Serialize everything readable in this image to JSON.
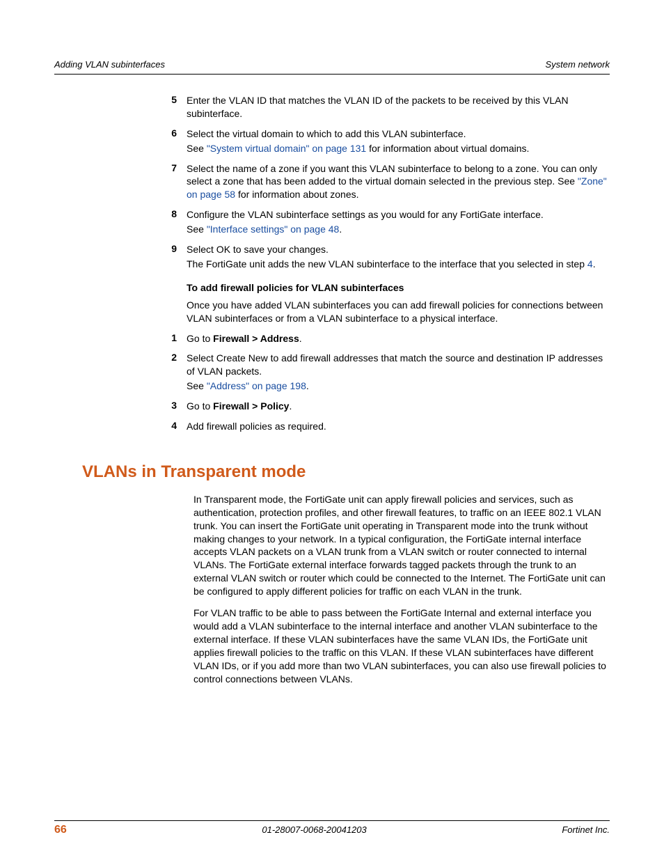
{
  "header": {
    "left": "Adding VLAN subinterfaces",
    "right": "System network"
  },
  "steps1": [
    {
      "n": "5",
      "lines": [
        {
          "segs": [
            {
              "t": "Enter the VLAN ID that matches the VLAN ID of the packets to be received by this VLAN subinterface."
            }
          ]
        }
      ]
    },
    {
      "n": "6",
      "lines": [
        {
          "segs": [
            {
              "t": "Select the virtual domain to which to add this VLAN subinterface."
            }
          ]
        },
        {
          "segs": [
            {
              "t": "See "
            },
            {
              "t": "\"System virtual domain\" on page 131",
              "link": true
            },
            {
              "t": " for information about virtual domains."
            }
          ]
        }
      ]
    },
    {
      "n": "7",
      "lines": [
        {
          "segs": [
            {
              "t": "Select the name of a zone if you want this VLAN subinterface to belong to a zone. You can only select a zone that has been added to the virtual domain selected in the previous step. See "
            },
            {
              "t": "\"Zone\" on page 58",
              "link": true
            },
            {
              "t": " for information about zones."
            }
          ]
        }
      ]
    },
    {
      "n": "8",
      "lines": [
        {
          "segs": [
            {
              "t": "Configure the VLAN subinterface settings as you would for any FortiGate interface."
            }
          ]
        },
        {
          "segs": [
            {
              "t": "See "
            },
            {
              "t": "\"Interface settings\" on page 48",
              "link": true
            },
            {
              "t": "."
            }
          ]
        }
      ]
    },
    {
      "n": "9",
      "lines": [
        {
          "segs": [
            {
              "t": "Select OK to save your changes."
            }
          ]
        },
        {
          "segs": [
            {
              "t": "The FortiGate unit adds the new VLAN subinterface to the interface that you selected in step "
            },
            {
              "t": "4",
              "link": true
            },
            {
              "t": "."
            }
          ]
        }
      ]
    }
  ],
  "sub_heading": "To add firewall policies for VLAN subinterfaces",
  "intro_para": "Once you have added VLAN subinterfaces you can add firewall policies for connections between VLAN subinterfaces or from a VLAN subinterface to a physical interface.",
  "steps2": [
    {
      "n": "1",
      "lines": [
        {
          "segs": [
            {
              "t": "Go to "
            },
            {
              "t": "Firewall > Address",
              "bold": true
            },
            {
              "t": "."
            }
          ]
        }
      ]
    },
    {
      "n": "2",
      "lines": [
        {
          "segs": [
            {
              "t": "Select Create New to add firewall addresses that match the source and destination IP addresses of VLAN packets."
            }
          ]
        },
        {
          "segs": [
            {
              "t": "See "
            },
            {
              "t": "\"Address\" on page 198",
              "link": true
            },
            {
              "t": "."
            }
          ]
        }
      ]
    },
    {
      "n": "3",
      "lines": [
        {
          "segs": [
            {
              "t": "Go to "
            },
            {
              "t": "Firewall > Policy",
              "bold": true
            },
            {
              "t": "."
            }
          ]
        }
      ]
    },
    {
      "n": "4",
      "lines": [
        {
          "segs": [
            {
              "t": "Add firewall policies as required."
            }
          ]
        }
      ]
    }
  ],
  "section_title": "VLANs in Transparent mode",
  "body_paras": [
    "In Transparent mode, the FortiGate unit can apply firewall policies and services, such as authentication, protection profiles, and other firewall features, to traffic on an IEEE 802.1 VLAN trunk. You can insert the FortiGate unit operating in Transparent mode into the trunk without making changes to your network. In a typical configuration, the FortiGate internal interface accepts VLAN packets on a VLAN trunk from a VLAN switch or router connected to internal VLANs. The FortiGate external interface forwards tagged packets through the trunk to an external VLAN switch or router which could be connected to the Internet. The FortiGate unit can be configured to apply different policies for traffic on each VLAN in the trunk.",
    "For VLAN traffic to be able to pass between the FortiGate Internal and external interface you would add a VLAN subinterface to the internal interface and another VLAN subinterface to the external interface. If these VLAN subinterfaces have the same VLAN IDs, the FortiGate unit applies firewall policies to the traffic on this VLAN. If these VLAN subinterfaces have different VLAN IDs, or if you add more than two VLAN subinterfaces, you can also use firewall policies to control connections between VLANs."
  ],
  "footer": {
    "page": "66",
    "docid": "01-28007-0068-20041203",
    "company": "Fortinet Inc."
  }
}
